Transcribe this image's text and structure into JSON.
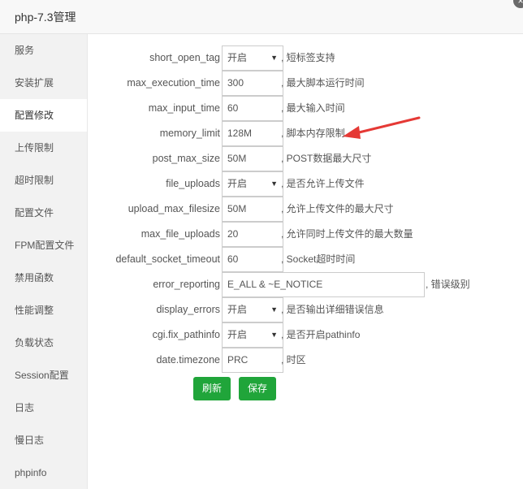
{
  "window": {
    "title": "php-7.3管理",
    "close_label": "×"
  },
  "sidebar": {
    "items": [
      {
        "label": "服务",
        "active": false
      },
      {
        "label": "安装扩展",
        "active": false
      },
      {
        "label": "配置修改",
        "active": true
      },
      {
        "label": "上传限制",
        "active": false
      },
      {
        "label": "超时限制",
        "active": false
      },
      {
        "label": "配置文件",
        "active": false
      },
      {
        "label": "FPM配置文件",
        "active": false
      },
      {
        "label": "禁用函数",
        "active": false
      },
      {
        "label": "性能调整",
        "active": false
      },
      {
        "label": "负载状态",
        "active": false
      },
      {
        "label": "Session配置",
        "active": false
      },
      {
        "label": "日志",
        "active": false
      },
      {
        "label": "慢日志",
        "active": false
      },
      {
        "label": "phpinfo",
        "active": false
      }
    ]
  },
  "config": {
    "rows": [
      {
        "key": "short_open_tag",
        "type": "select",
        "value": "开启",
        "desc": ", 短标签支持"
      },
      {
        "key": "max_execution_time",
        "type": "input",
        "value": "300",
        "desc": ", 最大脚本运行时间"
      },
      {
        "key": "max_input_time",
        "type": "input",
        "value": "60",
        "desc": ", 最大输入时间"
      },
      {
        "key": "memory_limit",
        "type": "input",
        "value": "128M",
        "desc": ", 脚本内存限制"
      },
      {
        "key": "post_max_size",
        "type": "input",
        "value": "50M",
        "desc": ", POST数据最大尺寸"
      },
      {
        "key": "file_uploads",
        "type": "select",
        "value": "开启",
        "desc": ", 是否允许上传文件"
      },
      {
        "key": "upload_max_filesize",
        "type": "input",
        "value": "50M",
        "desc": ", 允许上传文件的最大尺寸"
      },
      {
        "key": "max_file_uploads",
        "type": "input",
        "value": "20",
        "desc": ", 允许同时上传文件的最大数量"
      },
      {
        "key": "default_socket_timeout",
        "type": "input",
        "value": "60",
        "desc": ", Socket超时时间"
      },
      {
        "key": "error_reporting",
        "type": "input-wide",
        "value": "E_ALL & ~E_NOTICE",
        "desc": ", 错误级别"
      },
      {
        "key": "display_errors",
        "type": "select",
        "value": "开启",
        "desc": ", 是否输出详细错误信息"
      },
      {
        "key": "cgi.fix_pathinfo",
        "type": "select",
        "value": "开启",
        "desc": ", 是否开启pathinfo"
      },
      {
        "key": "date.timezone",
        "type": "input",
        "value": "PRC",
        "desc": ", 时区"
      }
    ]
  },
  "buttons": {
    "refresh_label": "刷新",
    "save_label": "保存"
  },
  "colors": {
    "primary_button": "#20a53a",
    "annotation_arrow": "#e53935"
  },
  "icons": {
    "dropdown": "▼",
    "annotation": "red-arrow-icon"
  }
}
